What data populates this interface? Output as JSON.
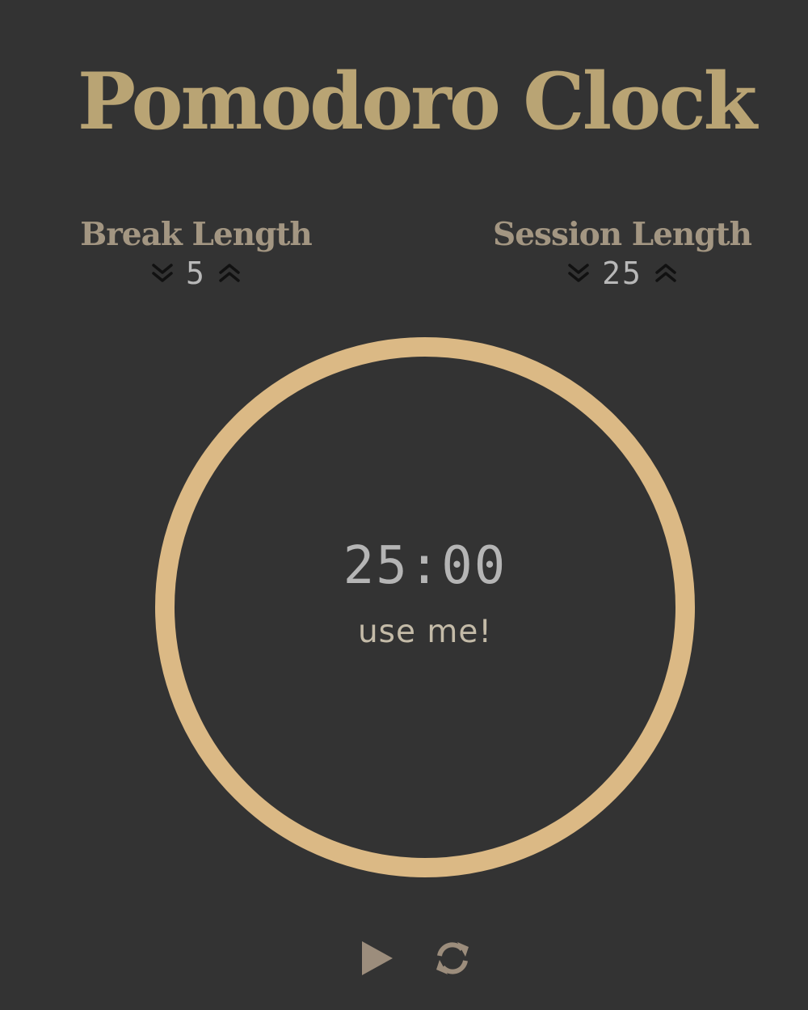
{
  "app": {
    "title": "Pomodoro Clock"
  },
  "break": {
    "label": "Break Length",
    "value": "5",
    "decrement_icon": "double-chevron-down-icon",
    "increment_icon": "double-chevron-up-icon"
  },
  "session": {
    "label": "Session Length",
    "value": "25",
    "decrement_icon": "double-chevron-down-icon",
    "increment_icon": "double-chevron-up-icon"
  },
  "timer": {
    "time": "25:00",
    "status": "use me!",
    "ring_color": "#dbb985"
  },
  "controls": {
    "play_icon": "play-icon",
    "reset_icon": "refresh-icon"
  },
  "colors": {
    "background": "#333333",
    "title": "#b9a474",
    "label": "#a39682",
    "arrow": "#111111",
    "control": "#9c8d7c"
  }
}
